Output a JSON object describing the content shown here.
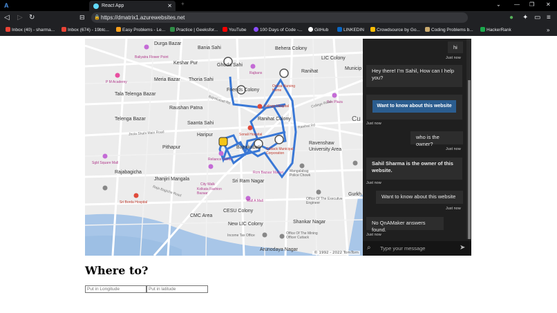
{
  "browser": {
    "tabs": [
      {
        "label": "React App",
        "active": true
      }
    ],
    "url": "https://dmatrix1.azurewebsites.net",
    "bookmarks": [
      {
        "label": "Inbox (40) - sharma...",
        "icon": "gmail-icon",
        "color": "#ea4335"
      },
      {
        "label": "Inbox (674) - 19btc...",
        "icon": "gmail-icon",
        "color": "#ea4335"
      },
      {
        "label": "Easy Problems - Le...",
        "icon": "leetcode-icon",
        "color": "#f89f1b"
      },
      {
        "label": "Practice | Geeksfor...",
        "icon": "gfg-icon",
        "color": "#2f8d46"
      },
      {
        "label": "YouTube",
        "icon": "youtube-icon",
        "color": "#ff0000"
      },
      {
        "label": "100 Days of Code -...",
        "icon": "code-icon",
        "color": "#8a4dff"
      },
      {
        "label": "GitHub",
        "icon": "github-icon",
        "color": "#ffffff"
      },
      {
        "label": "LINKEDIN",
        "icon": "linkedin-icon",
        "color": "#0a66c2"
      },
      {
        "label": "Crowdsource by Go...",
        "icon": "crowdsource-icon",
        "color": "#fbbc04"
      },
      {
        "label": "Coding Problems b...",
        "icon": "cc-icon",
        "color": "#c9a96e"
      },
      {
        "label": "HackerRank",
        "icon": "hackerrank-icon",
        "color": "#1ba94c"
      }
    ]
  },
  "map": {
    "labels": [
      {
        "text": "Durga Bazar",
        "kind": "area"
      },
      {
        "text": "Bania Sahi",
        "kind": "area"
      },
      {
        "text": "Behera Colony",
        "kind": "area"
      },
      {
        "text": "Keshar Pur",
        "kind": "area"
      },
      {
        "text": "Ghoda Sahi",
        "kind": "area"
      },
      {
        "text": "LIC Colony",
        "kind": "area"
      },
      {
        "text": "Meria Bazar",
        "kind": "area"
      },
      {
        "text": "Thoria Sahi",
        "kind": "area"
      },
      {
        "text": "Ranihat",
        "kind": "area"
      },
      {
        "text": "Municip",
        "kind": "area"
      },
      {
        "text": "Tala Telenga Bazar",
        "kind": "area"
      },
      {
        "text": "Friends Colony",
        "kind": "area"
      },
      {
        "text": "Raushan Patna",
        "kind": "area"
      },
      {
        "text": "Telenga Bazar",
        "kind": "area"
      },
      {
        "text": "Saanta Sahi",
        "kind": "area"
      },
      {
        "text": "Ranihat Colony",
        "kind": "area"
      },
      {
        "text": "Haripur",
        "kind": "area"
      },
      {
        "text": "Pithapur",
        "kind": "area"
      },
      {
        "text": "Bajrakabati",
        "kind": "area"
      },
      {
        "text": "Ravenshaw University Area",
        "kind": "area"
      },
      {
        "text": "Rajabagicha",
        "kind": "area"
      },
      {
        "text": "Jhanjiri Mangala",
        "kind": "area"
      },
      {
        "text": "Sri Ram Nagar",
        "kind": "area"
      },
      {
        "text": "CMC Area",
        "kind": "area"
      },
      {
        "text": "CESU Colony",
        "kind": "area"
      },
      {
        "text": "New LIC Colony",
        "kind": "area"
      },
      {
        "text": "Shankar Nagar",
        "kind": "area"
      },
      {
        "text": "Arunodaya Nagar",
        "kind": "area"
      },
      {
        "text": "Gurkh",
        "kind": "area"
      },
      {
        "text": "Cu",
        "kind": "big"
      },
      {
        "text": "P M Academy",
        "kind": "poi"
      },
      {
        "text": "Baliyatra Flower Point",
        "kind": "poi"
      },
      {
        "text": "Rajbans",
        "kind": "poi"
      },
      {
        "text": "Orissa Nursing Home",
        "kind": "hospital"
      },
      {
        "text": "Kalinga Hospital",
        "kind": "hospital"
      },
      {
        "text": "Rex Plaza",
        "kind": "poi"
      },
      {
        "text": "Sonali Hospital",
        "kind": "hospital"
      },
      {
        "text": "Cuttack Municipal Corporation",
        "kind": "gov"
      },
      {
        "text": "Sgbl Square Mall",
        "kind": "poi"
      },
      {
        "text": "Reliance Trend",
        "kind": "poi"
      },
      {
        "text": "Rcm Bazaar Market",
        "kind": "poi"
      },
      {
        "text": "Mangalabag Police Chowk",
        "kind": "gov"
      },
      {
        "text": "City Walk",
        "kind": "poi"
      },
      {
        "text": "Kolkata Fashion Bazaar",
        "kind": "poi"
      },
      {
        "text": "Mall A Mall",
        "kind": "poi"
      },
      {
        "text": "Office Of The Executive Engineer",
        "kind": "gov"
      },
      {
        "text": "Sri Borda Hospital",
        "kind": "hospital"
      },
      {
        "text": "Income Tax Office",
        "kind": "gov"
      },
      {
        "text": "Office Of The Mining Officer Cuttack",
        "kind": "gov"
      },
      {
        "text": "Jhola Shahi Main Road",
        "kind": "road"
      },
      {
        "text": "Bajrakabati Rd",
        "kind": "road"
      },
      {
        "text": "College Road",
        "kind": "road"
      },
      {
        "text": "Raja Bagicha Road",
        "kind": "road"
      },
      {
        "text": "Ranihat Rd",
        "kind": "road"
      }
    ],
    "copyright": "© 1992 - 2022 TomTom",
    "route_color": "#3a78d6"
  },
  "chat": {
    "messages": [
      {
        "from": "user",
        "text": "hi",
        "time": "Just now"
      },
      {
        "from": "bot",
        "text": "Hey there! I'm Sahil, How can I help you?",
        "time": ""
      },
      {
        "from": "bot-button",
        "text": "Want to know about this website",
        "time": "Just now"
      },
      {
        "from": "user",
        "text": "who is the owner?",
        "time": "Just now"
      },
      {
        "from": "bot",
        "text": "Sahil Sharma is the owner of this website.",
        "time": "Just now"
      },
      {
        "from": "user",
        "text": "Want to know about this website",
        "time": "Just now"
      },
      {
        "from": "bot",
        "text": "No QnAMaker answers found.",
        "time": "Just now"
      }
    ],
    "input_placeholder": "Type your message"
  },
  "page": {
    "heading": "Where to?",
    "longitude_placeholder": "Put in Longitude",
    "latitude_placeholder": "Put in latitude"
  }
}
